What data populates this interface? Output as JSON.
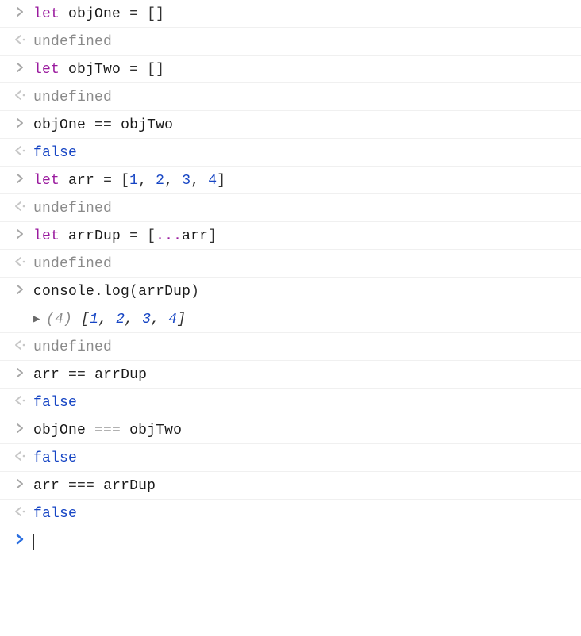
{
  "console": {
    "entries": [
      {
        "kind": "input",
        "tokens": [
          {
            "t": "let",
            "cls": "c-keyword"
          },
          {
            "t": " ",
            "cls": ""
          },
          {
            "t": "objOne",
            "cls": "c-var"
          },
          {
            "t": " ",
            "cls": ""
          },
          {
            "t": "=",
            "cls": "c-op"
          },
          {
            "t": " ",
            "cls": ""
          },
          {
            "t": "[]",
            "cls": "c-punct"
          }
        ]
      },
      {
        "kind": "return",
        "tokens": [
          {
            "t": "undefined",
            "cls": "c-undef"
          }
        ]
      },
      {
        "kind": "input",
        "tokens": [
          {
            "t": "let",
            "cls": "c-keyword"
          },
          {
            "t": " ",
            "cls": ""
          },
          {
            "t": "objTwo",
            "cls": "c-var"
          },
          {
            "t": " ",
            "cls": ""
          },
          {
            "t": "=",
            "cls": "c-op"
          },
          {
            "t": " ",
            "cls": ""
          },
          {
            "t": "[]",
            "cls": "c-punct"
          }
        ]
      },
      {
        "kind": "return",
        "tokens": [
          {
            "t": "undefined",
            "cls": "c-undef"
          }
        ]
      },
      {
        "kind": "input",
        "tokens": [
          {
            "t": "objOne",
            "cls": "c-var"
          },
          {
            "t": " ",
            "cls": ""
          },
          {
            "t": "==",
            "cls": "c-op"
          },
          {
            "t": " ",
            "cls": ""
          },
          {
            "t": "objTwo",
            "cls": "c-var"
          }
        ]
      },
      {
        "kind": "return",
        "tokens": [
          {
            "t": "false",
            "cls": "c-bool"
          }
        ]
      },
      {
        "kind": "input",
        "tokens": [
          {
            "t": "let",
            "cls": "c-keyword"
          },
          {
            "t": " ",
            "cls": ""
          },
          {
            "t": "arr",
            "cls": "c-var"
          },
          {
            "t": " ",
            "cls": ""
          },
          {
            "t": "=",
            "cls": "c-op"
          },
          {
            "t": " ",
            "cls": ""
          },
          {
            "t": "[",
            "cls": "c-punct"
          },
          {
            "t": "1",
            "cls": "c-num"
          },
          {
            "t": ",",
            "cls": "c-punct"
          },
          {
            "t": " ",
            "cls": ""
          },
          {
            "t": "2",
            "cls": "c-num"
          },
          {
            "t": ",",
            "cls": "c-punct"
          },
          {
            "t": " ",
            "cls": ""
          },
          {
            "t": "3",
            "cls": "c-num"
          },
          {
            "t": ",",
            "cls": "c-punct"
          },
          {
            "t": " ",
            "cls": ""
          },
          {
            "t": "4",
            "cls": "c-num"
          },
          {
            "t": "]",
            "cls": "c-punct"
          }
        ]
      },
      {
        "kind": "return",
        "tokens": [
          {
            "t": "undefined",
            "cls": "c-undef"
          }
        ]
      },
      {
        "kind": "input",
        "tokens": [
          {
            "t": "let",
            "cls": "c-keyword"
          },
          {
            "t": " ",
            "cls": ""
          },
          {
            "t": "arrDup",
            "cls": "c-var"
          },
          {
            "t": " ",
            "cls": ""
          },
          {
            "t": "=",
            "cls": "c-op"
          },
          {
            "t": " ",
            "cls": ""
          },
          {
            "t": "[",
            "cls": "c-punct"
          },
          {
            "t": "...",
            "cls": "c-keyword"
          },
          {
            "t": "arr",
            "cls": "c-var"
          },
          {
            "t": "]",
            "cls": "c-punct"
          }
        ]
      },
      {
        "kind": "return",
        "tokens": [
          {
            "t": "undefined",
            "cls": "c-undef"
          }
        ]
      },
      {
        "kind": "input",
        "tokens": [
          {
            "t": "console",
            "cls": "c-var"
          },
          {
            "t": ".",
            "cls": "c-punct"
          },
          {
            "t": "log",
            "cls": "c-var"
          },
          {
            "t": "(",
            "cls": "c-punct"
          },
          {
            "t": "arrDup",
            "cls": "c-var"
          },
          {
            "t": ")",
            "cls": "c-punct"
          }
        ]
      },
      {
        "kind": "log",
        "expandable": true,
        "tokens": [
          {
            "t": "(4)",
            "cls": "log-italic c-undef"
          },
          {
            "t": " ",
            "cls": ""
          },
          {
            "t": "[",
            "cls": "log-italic"
          },
          {
            "t": "1",
            "cls": "c-num log-italic"
          },
          {
            "t": ", ",
            "cls": "log-italic"
          },
          {
            "t": "2",
            "cls": "c-num log-italic"
          },
          {
            "t": ", ",
            "cls": "log-italic"
          },
          {
            "t": "3",
            "cls": "c-num log-italic"
          },
          {
            "t": ", ",
            "cls": "log-italic"
          },
          {
            "t": "4",
            "cls": "c-num log-italic"
          },
          {
            "t": "]",
            "cls": "log-italic"
          }
        ]
      },
      {
        "kind": "return",
        "tokens": [
          {
            "t": "undefined",
            "cls": "c-undef"
          }
        ]
      },
      {
        "kind": "input",
        "tokens": [
          {
            "t": "arr",
            "cls": "c-var"
          },
          {
            "t": " ",
            "cls": ""
          },
          {
            "t": "==",
            "cls": "c-op"
          },
          {
            "t": " ",
            "cls": ""
          },
          {
            "t": "arrDup",
            "cls": "c-var"
          }
        ]
      },
      {
        "kind": "return",
        "tokens": [
          {
            "t": "false",
            "cls": "c-bool"
          }
        ]
      },
      {
        "kind": "input",
        "tokens": [
          {
            "t": "objOne",
            "cls": "c-var"
          },
          {
            "t": " ",
            "cls": ""
          },
          {
            "t": "===",
            "cls": "c-op"
          },
          {
            "t": " ",
            "cls": ""
          },
          {
            "t": "objTwo",
            "cls": "c-var"
          }
        ]
      },
      {
        "kind": "return",
        "tokens": [
          {
            "t": "false",
            "cls": "c-bool"
          }
        ]
      },
      {
        "kind": "input",
        "tokens": [
          {
            "t": "arr",
            "cls": "c-var"
          },
          {
            "t": " ",
            "cls": ""
          },
          {
            "t": "===",
            "cls": "c-op"
          },
          {
            "t": " ",
            "cls": ""
          },
          {
            "t": "arrDup",
            "cls": "c-var"
          }
        ]
      },
      {
        "kind": "return",
        "tokens": [
          {
            "t": "false",
            "cls": "c-bool"
          }
        ]
      },
      {
        "kind": "active-input"
      }
    ]
  }
}
